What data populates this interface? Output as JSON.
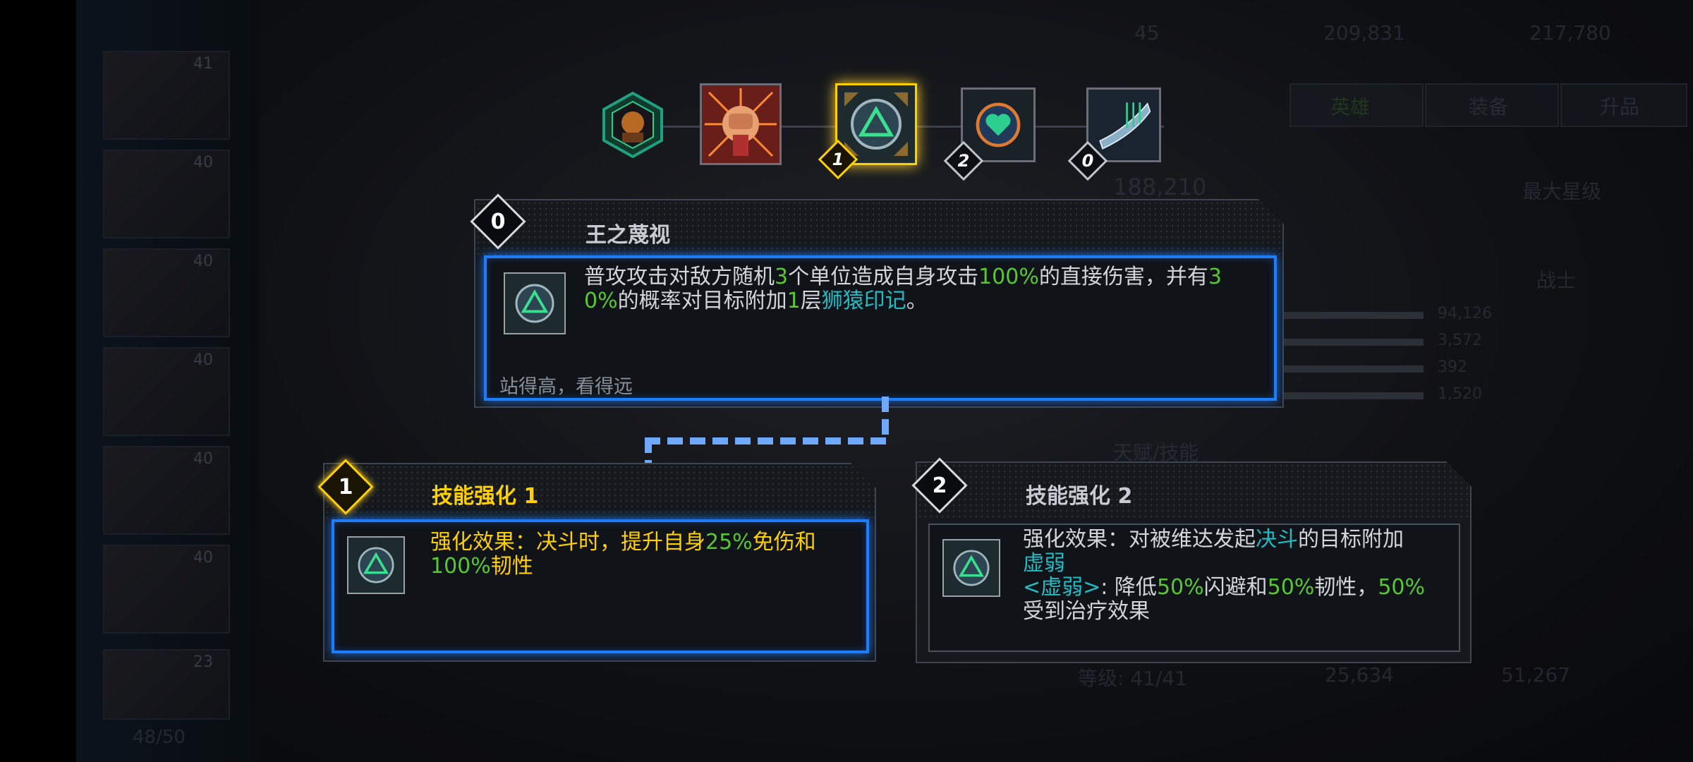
{
  "background": {
    "top_counter": "45",
    "currency1": "209,831",
    "currency2": "217,780",
    "tabs": [
      "英雄",
      "装备",
      "升品"
    ],
    "power": "188,210",
    "max_star": "最大星级",
    "class": "战士",
    "stats": [
      "94,126",
      "3,572",
      "392",
      "1,520"
    ],
    "talent_label": "天赋/技能",
    "level": "等级: 41/41",
    "cost1": "25,634",
    "cost2": "51,267",
    "roster_count": "48/50",
    "roster_levels": [
      "41",
      "40",
      "40",
      "40",
      "40",
      "40"
    ],
    "bottom_card_level": "23"
  },
  "skill_nodes": [
    {
      "name": "avatar-node",
      "badge": ""
    },
    {
      "name": "fist-node",
      "badge": ""
    },
    {
      "name": "triangle-node",
      "badge": "1",
      "selected": true
    },
    {
      "name": "heart-node",
      "badge": "2"
    },
    {
      "name": "blade-node",
      "badge": "0"
    }
  ],
  "main_skill": {
    "badge": "0",
    "title": "王之蔑视",
    "desc": {
      "p1": "普攻攻击对敌方随机",
      "n1": "3",
      "p2": "个单位造成自身攻击",
      "n2": "100%",
      "p3": "的直接伤害，并有",
      "n3": "3",
      "n3b": "0%",
      "p4": "的概率对目标附加",
      "n4": "1",
      "p5": "层",
      "k1": "狮猿印记",
      "p6": "。"
    },
    "flavor": "站得高，看得远"
  },
  "enhance1": {
    "badge": "1",
    "title": "技能强化 1",
    "line1a": "强化效果：决斗时，提升自身",
    "line1n": "25%",
    "line1b": "免伤和",
    "line2n": "100%",
    "line2b": "韧性"
  },
  "enhance2": {
    "badge": "2",
    "title": "技能强化 2",
    "l1a": "强化效果：对被维达发起",
    "l1k": "决斗",
    "l1b": "的目标附加",
    "l2k": "虚弱",
    "l3k": "<虚弱>",
    "l3a": ": 降低",
    "l3n1": "50%",
    "l3b": "闪避和",
    "l3n2": "50%",
    "l3c": "韧性，",
    "l3n3": "50%",
    "l4": "受到治疗效果"
  },
  "colors": {
    "gold": "#ffd000",
    "green": "#58c832",
    "cyan": "#1fbcc4",
    "blue_frame": "#1e7cff"
  }
}
